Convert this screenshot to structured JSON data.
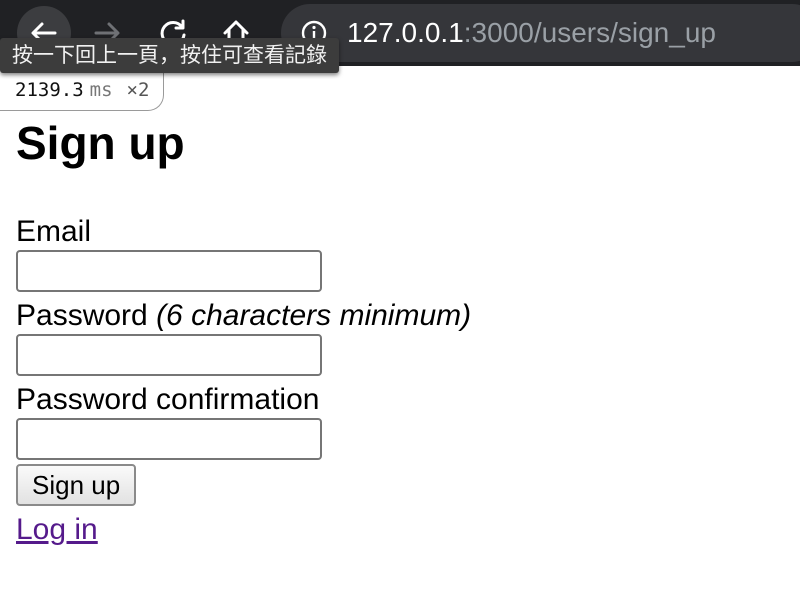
{
  "browser": {
    "url_host": "127.0.0.1",
    "url_path": ":3000/users/sign_up",
    "back_tooltip": "按一下回上一頁，按住可查看記錄",
    "icons": {
      "back": "arrow-left-icon",
      "forward": "arrow-right-icon",
      "reload": "reload-icon",
      "home": "home-icon",
      "info": "info-icon"
    }
  },
  "profiler": {
    "time": "2139.3",
    "unit": "ms",
    "count": "×2"
  },
  "page": {
    "title": "Sign up",
    "email_label": "Email",
    "password_label": "Password",
    "password_hint": "(6 characters minimum)",
    "confirm_label": "Password confirmation",
    "submit_label": "Sign up",
    "login_link": "Log in",
    "email_value": "",
    "password_value": "",
    "confirm_value": ""
  },
  "colors": {
    "chrome_bg": "#202124",
    "omnibox_bg": "#35363a",
    "visited_link": "#551a8b"
  }
}
